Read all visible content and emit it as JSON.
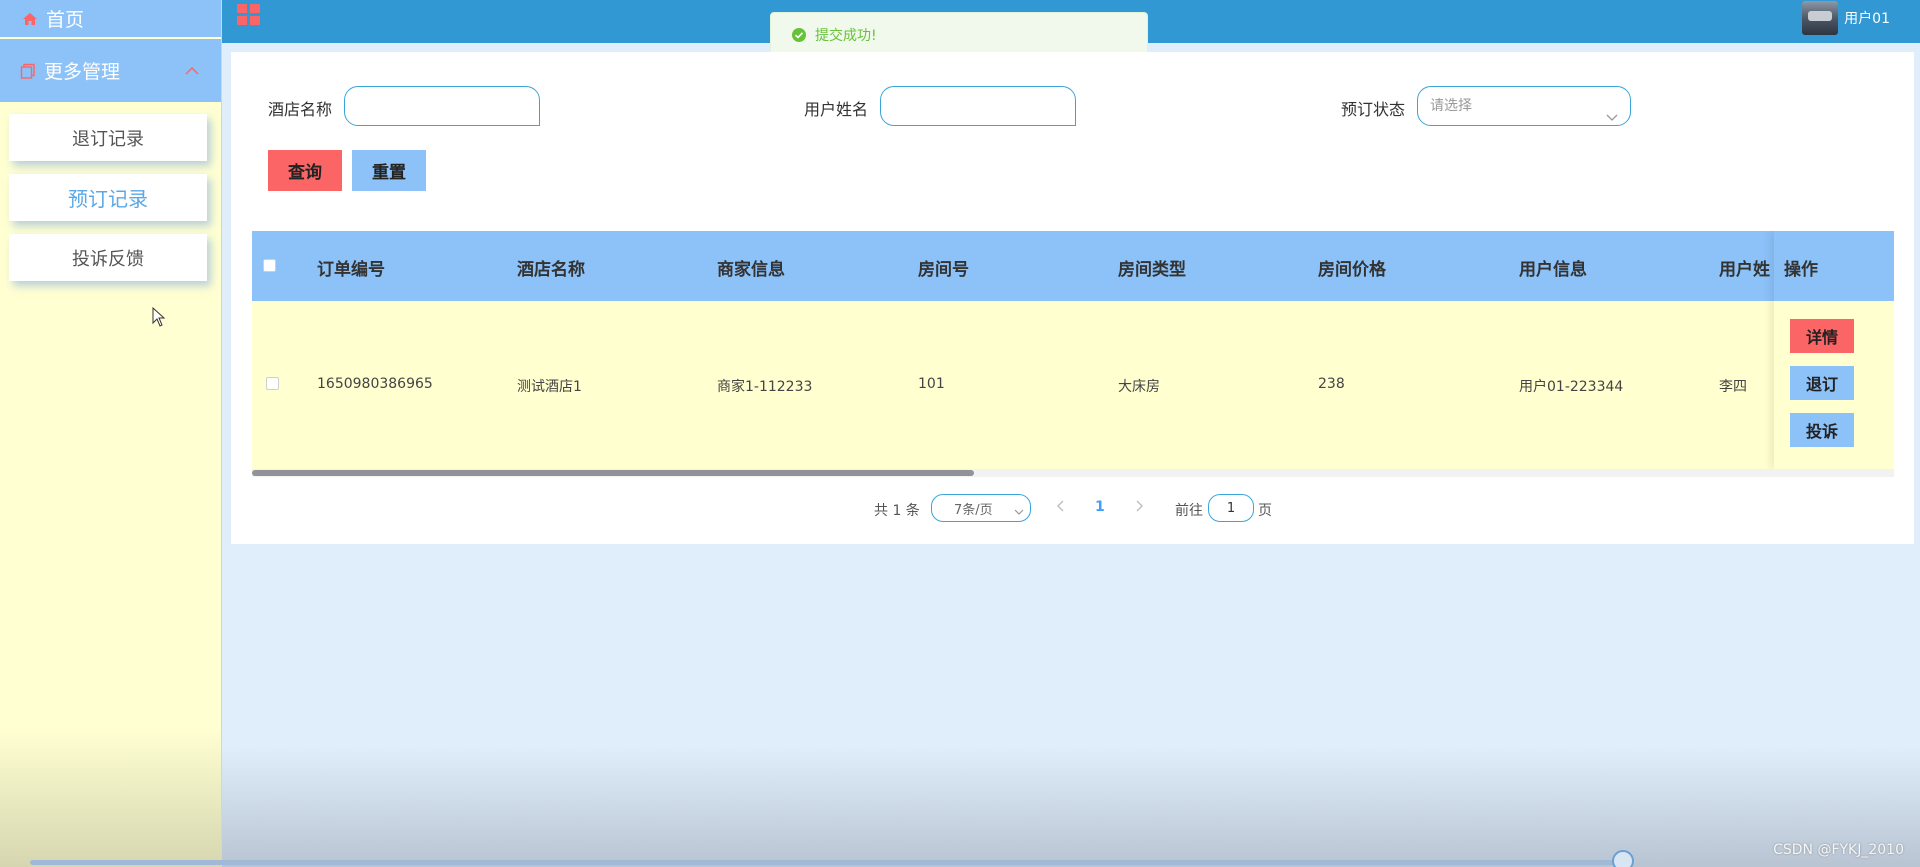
{
  "sidebar": {
    "home_label": "首页",
    "more_label": "更多管理",
    "items": [
      {
        "label": "退订记录"
      },
      {
        "label": "预订记录"
      },
      {
        "label": "投诉反馈"
      }
    ]
  },
  "topbar": {
    "user_name": "用户01"
  },
  "toast": {
    "message": "提交成功!"
  },
  "filters": {
    "hotel_name_label": "酒店名称",
    "user_name_label": "用户姓名",
    "status_label": "预订状态",
    "status_placeholder": "请选择",
    "query_button": "查询",
    "reset_button": "重置"
  },
  "table": {
    "headers": [
      "订单编号",
      "酒店名称",
      "商家信息",
      "房间号",
      "房间类型",
      "房间价格",
      "用户信息",
      "用户姓",
      "操作"
    ],
    "rows": [
      {
        "order_no": "1650980386965",
        "hotel_name": "测试酒店1",
        "merchant_info": "商家1-112233",
        "room_no": "101",
        "room_type": "大床房",
        "room_price": "238",
        "user_info": "用户01-223344",
        "user_name": "李四"
      }
    ],
    "actions": {
      "detail": "详情",
      "cancel": "退订",
      "complain": "投诉"
    },
    "scroll_fraction": 0.44
  },
  "pagination": {
    "total_text": "共 1 条",
    "page_size": "7条/页",
    "current_page": "1",
    "goto_label": "前往",
    "goto_value": "1",
    "page_suffix": "页"
  },
  "watermark": "CSDN @FYKJ_2010",
  "colors": {
    "sidebar_bg": "#ffffd2",
    "accent_blue": "#8cc2f8",
    "topbar_blue": "#3298d3",
    "accent_red": "#fb6565",
    "toast_green": "#67c23a"
  }
}
